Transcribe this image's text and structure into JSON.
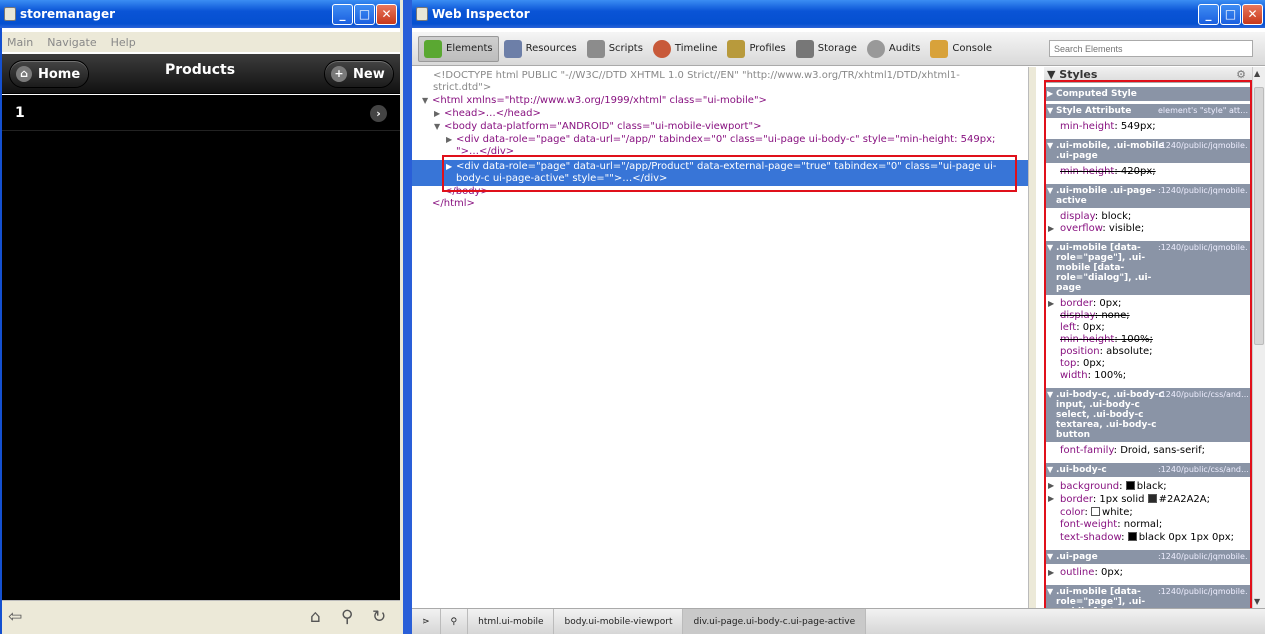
{
  "store_window": {
    "title": "storemanager",
    "menu": [
      "Main",
      "Navigate",
      "Help"
    ],
    "header": {
      "home_label": "Home",
      "title": "Products",
      "new_label": "New"
    },
    "list": [
      {
        "label": "1"
      }
    ]
  },
  "inspector_window": {
    "title": "Web Inspector",
    "toolbar": [
      "Elements",
      "Resources",
      "Scripts",
      "Timeline",
      "Profiles",
      "Storage",
      "Audits",
      "Console"
    ],
    "search_placeholder": "Search Elements",
    "dom": {
      "doctype": "<!DOCTYPE html PUBLIC \"-//W3C//DTD XHTML 1.0 Strict//EN\" \"http://www.w3.org/TR/xhtml1/DTD/xhtml1-",
      "doctype2": "strict.dtd\">",
      "html_open": "<html xmlns=\"http://www.w3.org/1999/xhtml\" class=\"ui-mobile\">",
      "head": "<head>…</head>",
      "body_open": "<body data-platform=\"ANDROID\" class=\"ui-mobile-viewport\">",
      "div1": "<div data-role=\"page\" data-url=\"/app/\" tabindex=\"0\" class=\"ui-page ui-body-c\" style=\"min-height: 549px;",
      "div1b": "\">…</div>",
      "div2": "<div data-role=\"page\" data-url=\"/app/Product\" data-external-page=\"true\" tabindex=\"0\" class=\"ui-page ui-",
      "div2b": "body-c ui-page-active\" style=\"\">…</div>",
      "body_close": "</body>",
      "html_close": "</html>"
    },
    "styles": {
      "header": "Styles",
      "computed": "Computed Style",
      "sections": [
        {
          "selector": "Style Attribute",
          "source": "element's \"style\" att…",
          "props": [
            {
              "name": "min-height",
              "value": "549px;",
              "strike": false
            }
          ]
        },
        {
          "selector": ".ui-mobile, .ui-mobile .ui-page",
          "source": ":1240/public/jqmobile…",
          "props": [
            {
              "name": "min-height",
              "value": "420px;",
              "strike": true
            }
          ]
        },
        {
          "selector": ".ui-mobile .ui-page-active",
          "source": ":1240/public/jqmobile…",
          "props": [
            {
              "name": "display",
              "value": "block;",
              "strike": false
            },
            {
              "name": "overflow",
              "value": "visible;",
              "strike": false,
              "tri": true
            }
          ]
        },
        {
          "selector": ".ui-mobile [data-role=\"page\"], .ui-mobile [data-role=\"dialog\"], .ui-page",
          "source": ":1240/public/jqmobile…",
          "props": [
            {
              "name": "border",
              "value": "0px;",
              "strike": false,
              "tri": true
            },
            {
              "name": "display",
              "value": "none;",
              "strike": true
            },
            {
              "name": "left",
              "value": "0px;",
              "strike": false
            },
            {
              "name": "min-height",
              "value": "100%;",
              "strike": true
            },
            {
              "name": "position",
              "value": "absolute;",
              "strike": false
            },
            {
              "name": "top",
              "value": "0px;",
              "strike": false
            },
            {
              "name": "width",
              "value": "100%;",
              "strike": false
            }
          ]
        },
        {
          "selector": ".ui-body-c, .ui-body-c input, .ui-body-c select, .ui-body-c textarea, .ui-body-c button",
          "source": ":1240/public/css/and…",
          "props": [
            {
              "name": "font-family",
              "value": "Droid, sans-serif;",
              "strike": false
            }
          ]
        },
        {
          "selector": ".ui-body-c",
          "source": ":1240/public/css/and…",
          "props": [
            {
              "name": "background",
              "value": "black;",
              "strike": false,
              "tri": true,
              "swatch": "#000000"
            },
            {
              "name": "border",
              "value": "1px solid",
              "value2": "#2A2A2A;",
              "strike": false,
              "tri": true,
              "swatch": "#2A2A2A"
            },
            {
              "name": "color",
              "value": "white;",
              "strike": false,
              "swatch": "#ffffff"
            },
            {
              "name": "font-weight",
              "value": "normal;",
              "strike": false
            },
            {
              "name": "text-shadow",
              "value": "black 0px 1px 0px;",
              "strike": false,
              "swatch": "#000000"
            }
          ]
        },
        {
          "selector": ".ui-page",
          "source": ":1240/public/jqmobile…",
          "props": [
            {
              "name": "outline",
              "value": "0px;",
              "strike": false,
              "tri": true
            }
          ]
        },
        {
          "selector": ".ui-mobile [data-role=\"page\"], .ui-mobile [data-role=\"dialog\"], .ui-page",
          "source": ":1240/public/jqmobile…",
          "props": []
        }
      ]
    },
    "breadcrumbs": [
      "html.ui-mobile",
      "body.ui-mobile-viewport",
      "div.ui-page.ui-body-c.ui-page-active"
    ]
  }
}
